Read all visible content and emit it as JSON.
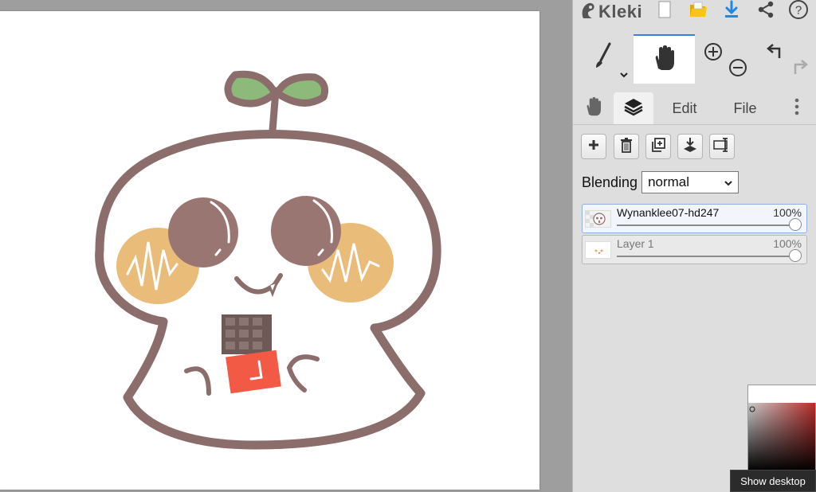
{
  "app": {
    "name": "Kleki"
  },
  "tabs": {
    "edit_label": "Edit",
    "file_label": "File"
  },
  "layers_panel": {
    "blending_label": "Blending",
    "blending_value": "normal",
    "layers": [
      {
        "name": "Wynanklee07-hd247",
        "opacity": "100%",
        "active": true
      },
      {
        "name": "Layer 1",
        "opacity": "100%",
        "active": false
      }
    ]
  },
  "tooltip": {
    "text": "Show desktop"
  },
  "colors": {
    "accent": "#3a7fe0",
    "download_icon": "#1e88e5",
    "folder_icon": "#f5c518",
    "outline": "#8b6d6b",
    "sprout_leaf": "#8dba7a",
    "cheek": "#e8b56c",
    "mouth_red": "#f25a45"
  },
  "icons": {
    "logo": "kleki-logo-icon",
    "new_file": "new-file-icon",
    "open_file": "open-folder-icon",
    "download": "download-icon",
    "share": "share-icon",
    "help": "help-icon",
    "brush": "brush-icon",
    "hand": "hand-icon",
    "zoom_in": "zoom-in-icon",
    "zoom_out": "zoom-out-icon",
    "undo": "undo-icon",
    "redo": "redo-icon",
    "layers": "layers-icon",
    "more": "more-vertical-icon",
    "add_layer": "plus-icon",
    "delete_layer": "trash-icon",
    "duplicate_layer": "duplicate-icon",
    "merge_down": "merge-down-icon",
    "rename_layer": "rename-icon"
  }
}
